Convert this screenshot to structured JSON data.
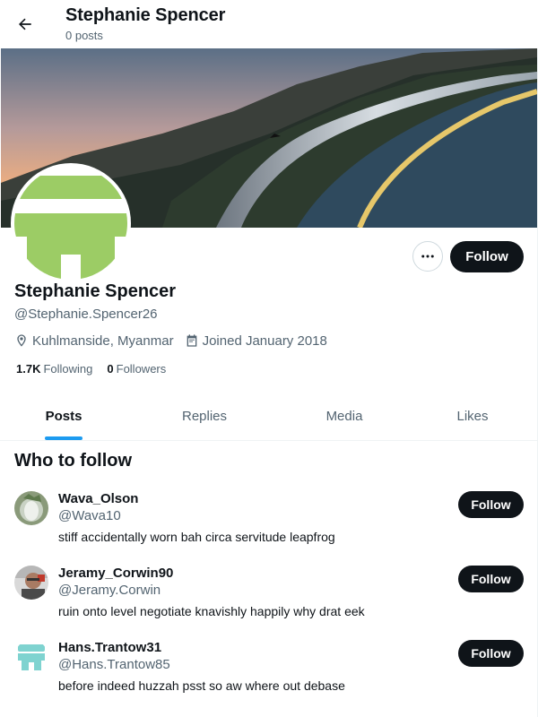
{
  "header": {
    "title": "Stephanie Spencer",
    "post_count": "0 posts"
  },
  "profile": {
    "name": "Stephanie Spencer",
    "handle": "@Stephanie.Spencer26",
    "location": "Kuhlmanside, Myanmar",
    "joined": "Joined January 2018",
    "following_count": "1.7K",
    "following_label": "Following",
    "followers_count": "0",
    "followers_label": "Followers",
    "follow_label": "Follow",
    "avatar_color": "#9ccc65"
  },
  "tabs": [
    {
      "label": "Posts",
      "active": true
    },
    {
      "label": "Replies",
      "active": false
    },
    {
      "label": "Media",
      "active": false
    },
    {
      "label": "Likes",
      "active": false
    }
  ],
  "who_to_follow": {
    "title": "Who to follow",
    "users": [
      {
        "name": "Wava_Olson",
        "handle": "@Wava10",
        "bio": "stiff accidentally worn bah circa servitude leapfrog",
        "follow_label": "Follow"
      },
      {
        "name": "Jeramy_Corwin90",
        "handle": "@Jeramy.Corwin",
        "bio": "ruin onto level negotiate knavishly happily why drat eek",
        "follow_label": "Follow"
      },
      {
        "name": "Hans.Trantow31",
        "handle": "@Hans.Trantow85",
        "bio": "before indeed huzzah psst so aw where out debase",
        "follow_label": "Follow"
      }
    ]
  },
  "colors": {
    "accent": "#1d9bf0",
    "button": "#0f1419",
    "muted": "#536471"
  },
  "icons": [
    "back-arrow-icon",
    "more-icon",
    "location-icon",
    "calendar-icon"
  ]
}
